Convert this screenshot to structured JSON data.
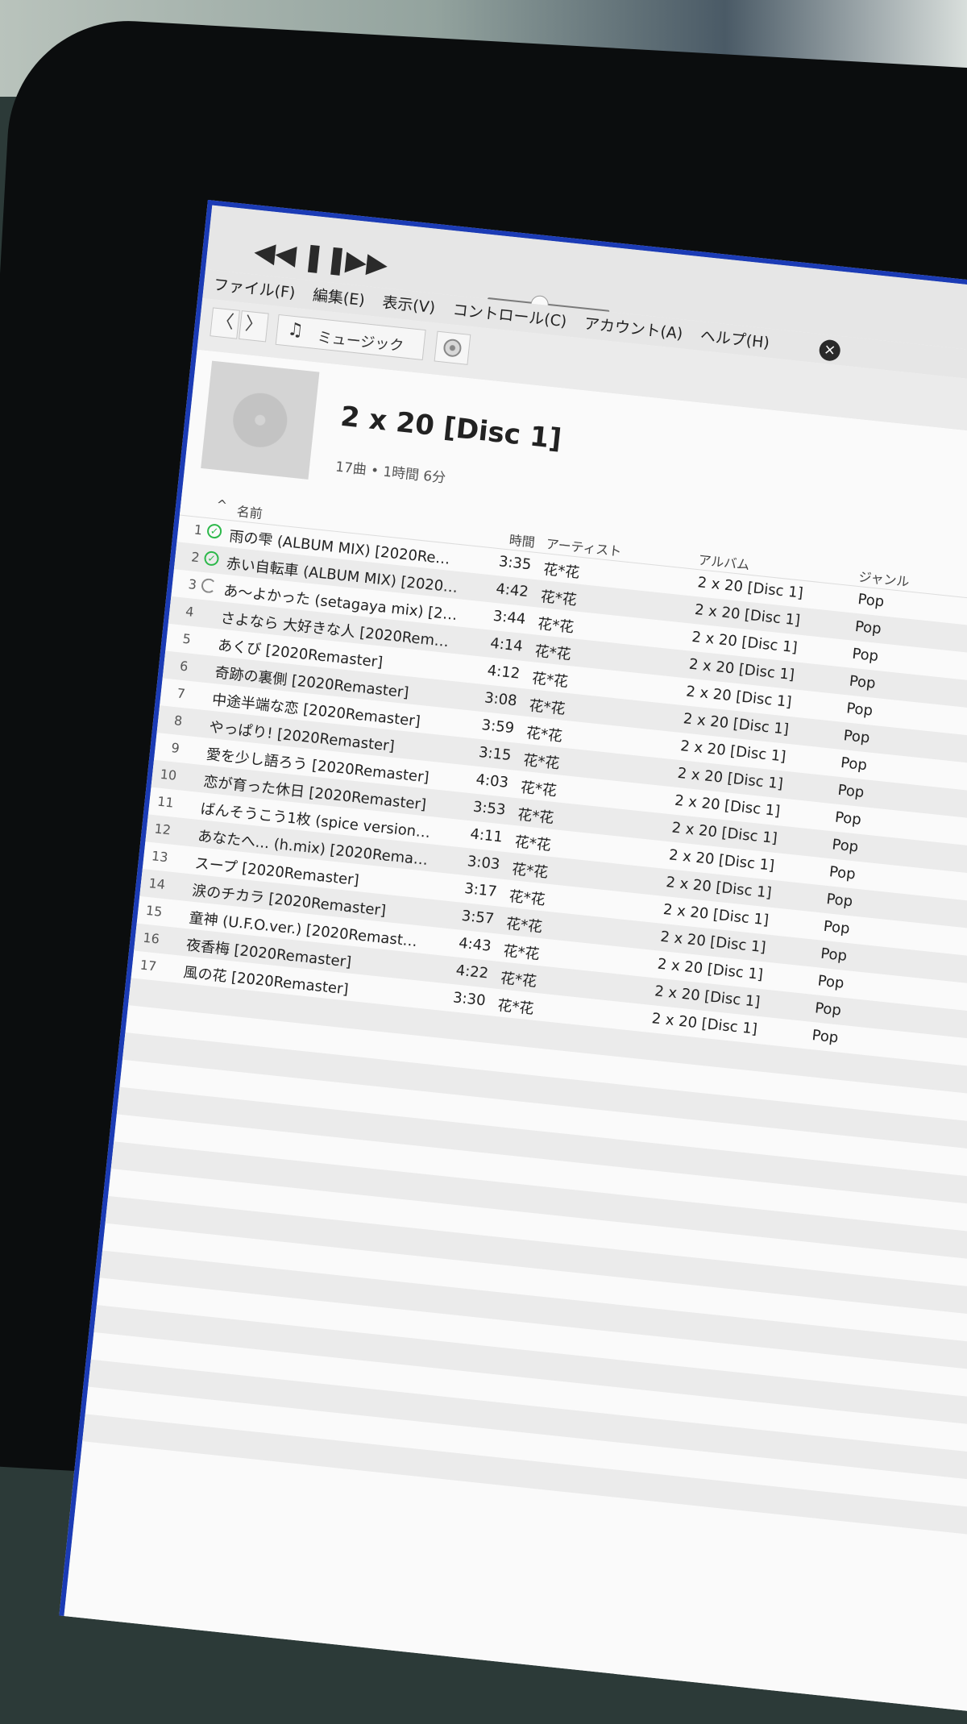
{
  "menu": [
    "ファイル(F)",
    "編集(E)",
    "表示(V)",
    "コントロール(C)",
    "アカウント(A)",
    "ヘルプ(H)"
  ],
  "controls": {
    "prev": "◀◀",
    "pause": "❚❚",
    "next": "▶▶",
    "close": "×"
  },
  "toolbar": {
    "back": "〈",
    "forward": "〉",
    "source_label": "ミュージック"
  },
  "album": {
    "title": "2 x 20 [Disc 1]",
    "subtitle": "17曲 • 1時間 6分"
  },
  "columns": {
    "sort_indicator": "^",
    "name": "名前",
    "time": "時間",
    "artist": "アーティスト",
    "album": "アルバム",
    "genre": "ジャンル"
  },
  "tracks": [
    {
      "num": "1",
      "status": "downloaded",
      "name": "雨の雫 (ALBUM MIX) [2020Remast...",
      "time": "3:35",
      "artist": "花*花",
      "album": "2 x 20 [Disc 1]",
      "genre": "Pop"
    },
    {
      "num": "2",
      "status": "downloaded",
      "name": "赤い自転車 (ALBUM MIX) [2020Re...",
      "time": "4:42",
      "artist": "花*花",
      "album": "2 x 20 [Disc 1]",
      "genre": "Pop"
    },
    {
      "num": "3",
      "status": "loading",
      "name": "あ〜よかった (setagaya mix) [2020R...",
      "time": "3:44",
      "artist": "花*花",
      "album": "2 x 20 [Disc 1]",
      "genre": "Pop"
    },
    {
      "num": "4",
      "status": "",
      "name": "さよなら 大好きな人 [2020Remaster]",
      "time": "4:14",
      "artist": "花*花",
      "album": "2 x 20 [Disc 1]",
      "genre": "Pop"
    },
    {
      "num": "5",
      "status": "",
      "name": "あくび [2020Remaster]",
      "time": "4:12",
      "artist": "花*花",
      "album": "2 x 20 [Disc 1]",
      "genre": "Pop"
    },
    {
      "num": "6",
      "status": "",
      "name": "奇跡の裏側 [2020Remaster]",
      "time": "3:08",
      "artist": "花*花",
      "album": "2 x 20 [Disc 1]",
      "genre": "Pop"
    },
    {
      "num": "7",
      "status": "",
      "name": "中途半端な恋 [2020Remaster]",
      "time": "3:59",
      "artist": "花*花",
      "album": "2 x 20 [Disc 1]",
      "genre": "Pop"
    },
    {
      "num": "8",
      "status": "",
      "name": "やっぱり! [2020Remaster]",
      "time": "3:15",
      "artist": "花*花",
      "album": "2 x 20 [Disc 1]",
      "genre": "Pop"
    },
    {
      "num": "9",
      "status": "",
      "name": "愛を少し語ろう [2020Remaster]",
      "time": "4:03",
      "artist": "花*花",
      "album": "2 x 20 [Disc 1]",
      "genre": "Pop"
    },
    {
      "num": "10",
      "status": "",
      "name": "恋が育った休日 [2020Remaster]",
      "time": "3:53",
      "artist": "花*花",
      "album": "2 x 20 [Disc 1]",
      "genre": "Pop"
    },
    {
      "num": "11",
      "status": "",
      "name": "ばんそうこう1枚 (spice version) [202...",
      "time": "4:11",
      "artist": "花*花",
      "album": "2 x 20 [Disc 1]",
      "genre": "Pop"
    },
    {
      "num": "12",
      "status": "",
      "name": "あなたへ... (h.mix) [2020Remaster]",
      "time": "3:03",
      "artist": "花*花",
      "album": "2 x 20 [Disc 1]",
      "genre": "Pop"
    },
    {
      "num": "13",
      "status": "",
      "name": "スープ [2020Remaster]",
      "time": "3:17",
      "artist": "花*花",
      "album": "2 x 20 [Disc 1]",
      "genre": "Pop"
    },
    {
      "num": "14",
      "status": "",
      "name": "涙のチカラ [2020Remaster]",
      "time": "3:57",
      "artist": "花*花",
      "album": "2 x 20 [Disc 1]",
      "genre": "Pop"
    },
    {
      "num": "15",
      "status": "",
      "name": "童神 (U.F.O.ver.) [2020Remaster]",
      "time": "4:43",
      "artist": "花*花",
      "album": "2 x 20 [Disc 1]",
      "genre": "Pop"
    },
    {
      "num": "16",
      "status": "",
      "name": "夜香梅 [2020Remaster]",
      "time": "4:22",
      "artist": "花*花",
      "album": "2 x 20 [Disc 1]",
      "genre": "Pop"
    },
    {
      "num": "17",
      "status": "",
      "name": "風の花 [2020Remaster]",
      "time": "3:30",
      "artist": "花*花",
      "album": "2 x 20 [Disc 1]",
      "genre": "Pop"
    }
  ],
  "colors": {
    "accent": "#2e6ee6",
    "check": "#2cb84a",
    "frame": "#1b3bb5"
  }
}
